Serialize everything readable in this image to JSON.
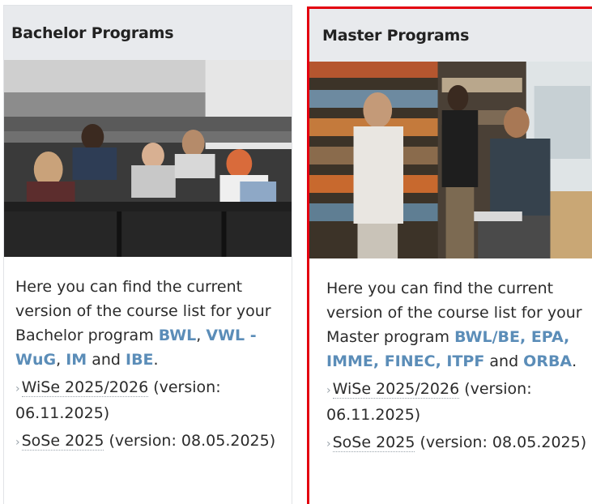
{
  "bachelor": {
    "title": "Bachelor Programs",
    "photo_alt": "students in lecture hall",
    "desc_prefix": "Here you can find the current version of the course list for your Bachelor program ",
    "links": [
      "BWL",
      "VWL - WuG",
      "IM",
      "IBE"
    ],
    "sep_comma": ", ",
    "sep_and": " and ",
    "end": ".",
    "versions": [
      {
        "arrow": "›",
        "term": "WiSe 2025/2026",
        "note": " (version: 06.11.2025)"
      },
      {
        "arrow": "›",
        "term": "SoSe 2025",
        "note": " (version: 08.05.2025)"
      }
    ]
  },
  "master": {
    "title": "Master Programs",
    "photo_alt": "students in library",
    "desc_prefix": "Here you can find the current version of the course list for your Master program ",
    "links": [
      "BWL/BE, EPA, IMME, FINEC, ITPF",
      "ORBA"
    ],
    "sep_and": " and ",
    "end": ".",
    "versions": [
      {
        "arrow": "›",
        "term": "WiSe 2025/2026",
        "note": " (version: 06.11.2025)"
      },
      {
        "arrow": "›",
        "term": "SoSe 2025",
        "note": " (version: 08.05.2025)"
      }
    ]
  },
  "colors": {
    "link": "#5b8db8",
    "highlight_border": "#e3000f",
    "header_bg": "#e8eaed"
  }
}
